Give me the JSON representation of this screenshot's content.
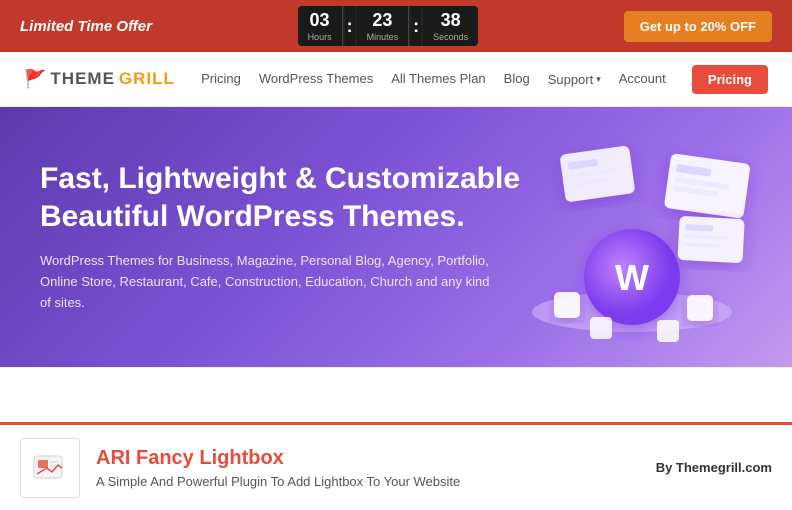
{
  "banner": {
    "offer_text": "Limited Time Offer",
    "discount_btn": "Get up to 20% OFF",
    "countdown": {
      "hours": {
        "value": "03",
        "label": "Hours"
      },
      "minutes": {
        "value": "23",
        "label": "Minutes"
      },
      "seconds": {
        "value": "38",
        "label": "Seconds"
      }
    }
  },
  "navbar": {
    "logo": {
      "theme_part": "THEME",
      "grill_part": "GRILL"
    },
    "links": [
      {
        "label": "Pricing",
        "id": "pricing"
      },
      {
        "label": "WordPress Themes",
        "id": "wp-themes"
      },
      {
        "label": "All Themes Plan",
        "id": "all-themes-plan"
      },
      {
        "label": "Blog",
        "id": "blog"
      },
      {
        "label": "Support",
        "id": "support"
      },
      {
        "label": "Account",
        "id": "account"
      }
    ],
    "pricing_btn": "Pricing"
  },
  "hero": {
    "title": "Fast, Lightweight & Customizable Beautiful WordPress Themes.",
    "subtitle": "WordPress Themes for Business, Magazine, Personal Blog, Agency, Portfolio, Online Store, Restaurant, Cafe, Construction, Education, Church and any kind of sites."
  },
  "plugin": {
    "name": "ARI Fancy Lightbox",
    "description": "A Simple And Powerful Plugin To Add Lightbox To Your Website",
    "author": "By Themegrill.com"
  }
}
